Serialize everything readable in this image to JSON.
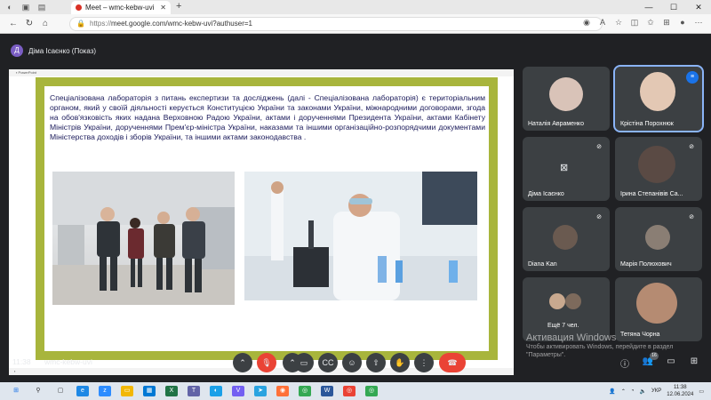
{
  "browser": {
    "tab_title": "Meet – wmc-kebw-uvi",
    "url_prefix": "https://",
    "url_rest": "meet.google.com/wmc-kebw-uvi?authuser=1"
  },
  "meet": {
    "presenter_initial": "Д",
    "presenter_label": "Діма Ісаєнко (Показ)",
    "clock": "11:38",
    "meeting_code": "wmc-kebw-uvi",
    "participants_badge": "16"
  },
  "slide": {
    "text": "Спеціалізована лабораторія з питань експертизи та досліджень (далі - Спеціалізована лабораторія) є територіальним органом, який у своїй діяльності керується Конституцією України та законами України, міжнародними договорами, згода на обов'язковість яких надана Верховною Радою України, актами і дорученнями Президента України, актами Кабінету Міністрів України, дорученнями Прем'єр-міністра України, наказами та іншими організаційно-розпорядчими документами Міністерства доходів і зборів України, та  іншими актами законодавства ."
  },
  "tiles": [
    {
      "name": "Наталія Авраменко"
    },
    {
      "name": "Крістіна Порохнюк"
    },
    {
      "name": "Діма Ісаєнко"
    },
    {
      "name": "Ірина Степанівів Са..."
    },
    {
      "name": "Diana Kan"
    },
    {
      "name": "Марія Полюхович"
    },
    {
      "name": "Ещё 7 чел."
    },
    {
      "name": "Тетяна Чорна"
    }
  ],
  "watermark": {
    "title": "Активация Windows",
    "text": "Чтобы активировать Windows, перейдите в раздел \"Параметры\"."
  },
  "taskbar": {
    "lang": "УКР",
    "time": "11:38",
    "date": "12.06.2024"
  },
  "colors": {
    "meet_bg": "#202124",
    "slide_border": "#a8b53c",
    "end_call": "#ea4335",
    "active_speaker": "#1a73e8"
  }
}
